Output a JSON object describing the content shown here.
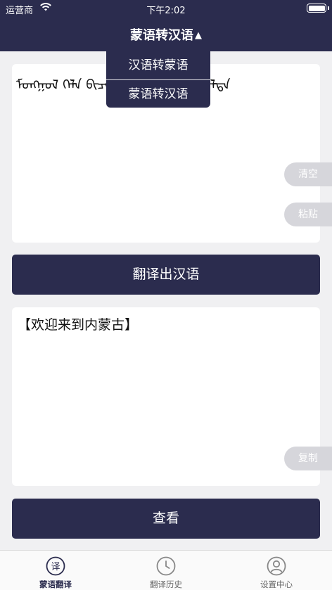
{
  "status_bar": {
    "carrier": "运营商",
    "time": "下午2:02"
  },
  "nav": {
    "title": "蒙语转汉语",
    "caret": "▲"
  },
  "dropdown": {
    "items": [
      "汉语转蒙语",
      "蒙语转汉语"
    ]
  },
  "input": {
    "text": "ᠮᠣᠩᠭᠣᠯ ᠬᠡᠯᠡ ᠪᠢᠴᠢᠭ ᠤᠨ ᠬᠤᠪᠢᠷᠠᠭᠤᠯᠤᠯᠲᠠ"
  },
  "side_buttons": {
    "clear": "清空",
    "paste": "粘贴",
    "copy": "复制"
  },
  "actions": {
    "translate": "翻译出汉语",
    "view": "查看"
  },
  "output": {
    "text": "【欢迎来到内蒙古】"
  },
  "tabbar": {
    "items": [
      {
        "label": "蒙语翻译",
        "icon": "translate-icon",
        "glyph": "译",
        "active": true
      },
      {
        "label": "翻译历史",
        "icon": "clock-icon",
        "active": false
      },
      {
        "label": "设置中心",
        "icon": "user-icon",
        "active": false
      }
    ]
  },
  "colors": {
    "primary": "#2b2c4e",
    "background": "#f0f0f2",
    "pill": "#d6d6db"
  }
}
